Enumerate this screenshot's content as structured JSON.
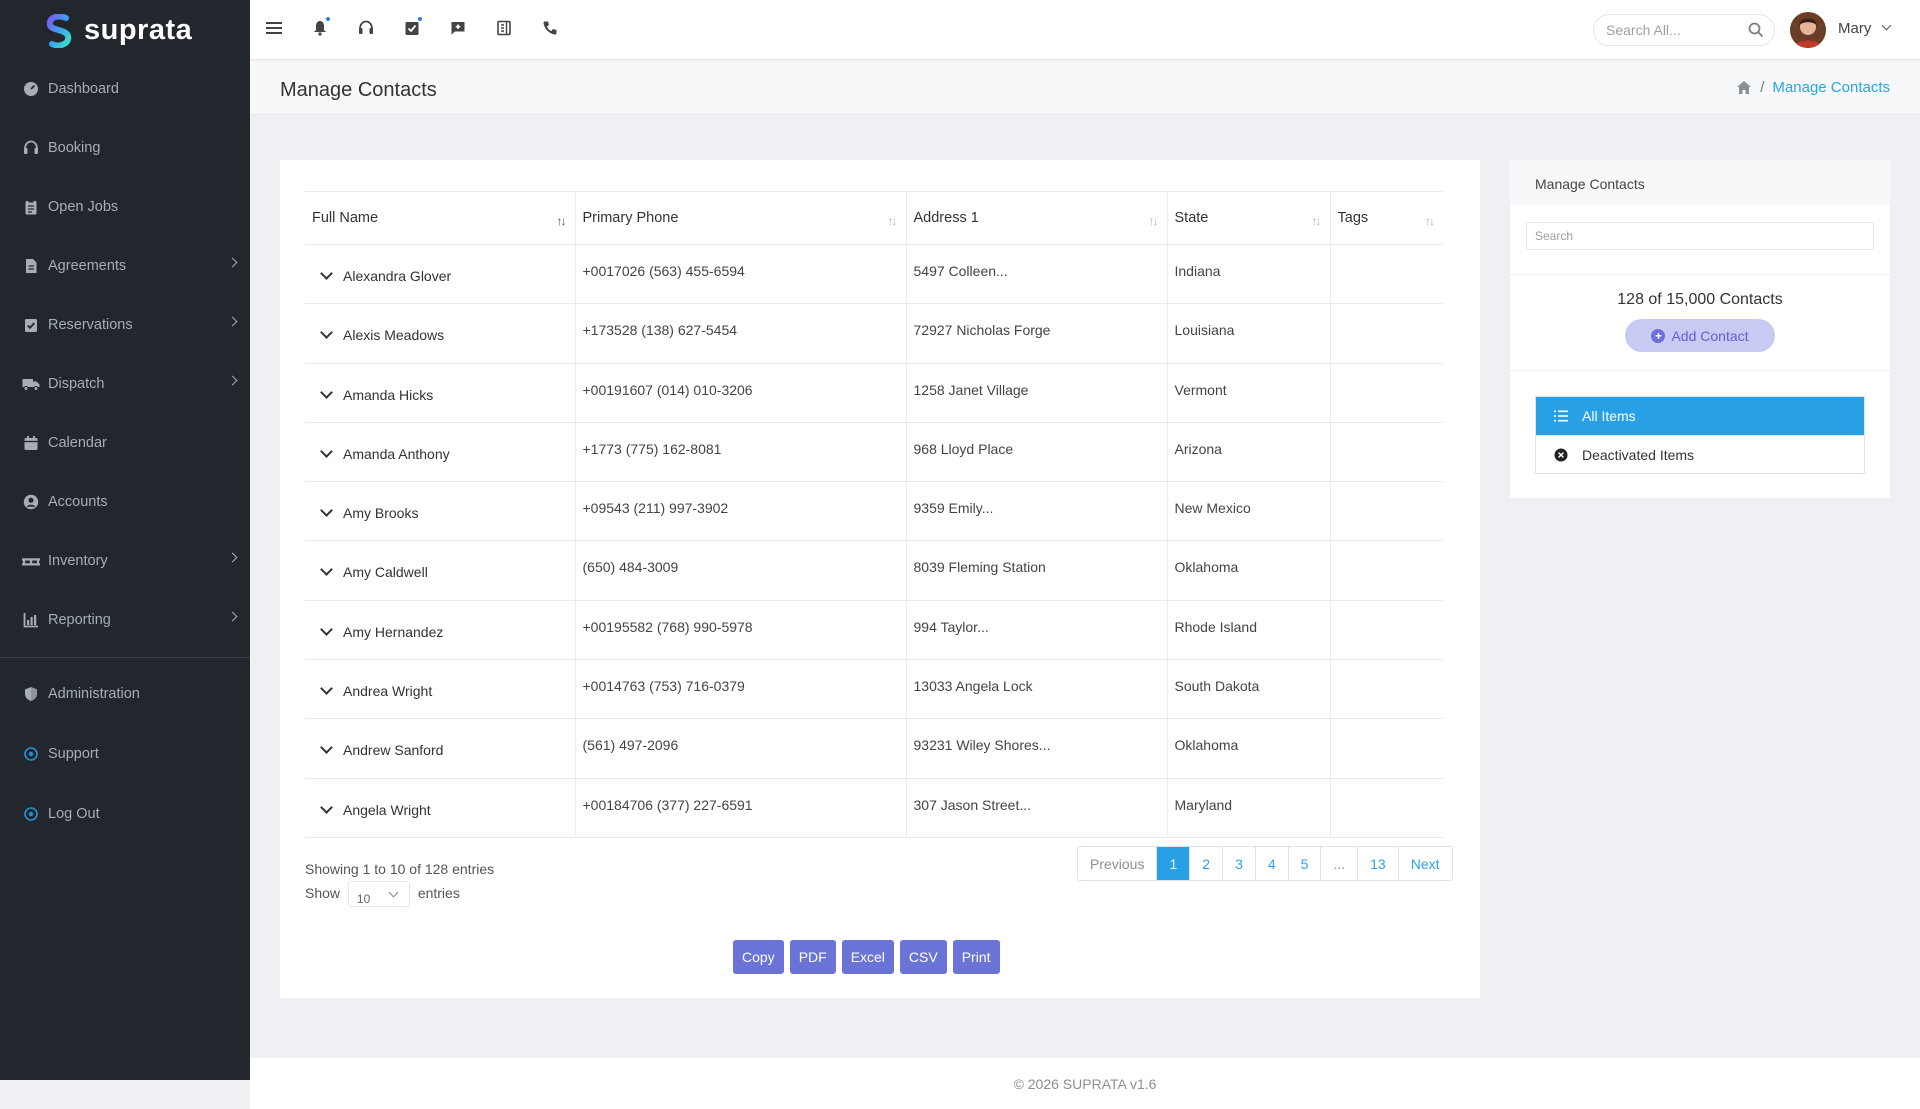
{
  "brand": {
    "name": "suprata"
  },
  "sidebar": {
    "items": [
      {
        "label": "Dashboard",
        "icon": "dashboard-icon",
        "has_submenu": false
      },
      {
        "label": "Booking",
        "icon": "headset-icon",
        "has_submenu": false
      },
      {
        "label": "Open Jobs",
        "icon": "clipboard-icon",
        "has_submenu": false
      },
      {
        "label": "Agreements",
        "icon": "document-icon",
        "has_submenu": true
      },
      {
        "label": "Reservations",
        "icon": "check-clipboard-icon",
        "has_submenu": true
      },
      {
        "label": "Dispatch",
        "icon": "truck-icon",
        "has_submenu": true
      },
      {
        "label": "Calendar",
        "icon": "calendar-icon",
        "has_submenu": false
      },
      {
        "label": "Accounts",
        "icon": "user-circle-icon",
        "has_submenu": false
      },
      {
        "label": "Inventory",
        "icon": "pallet-icon",
        "has_submenu": true
      },
      {
        "label": "Reporting",
        "icon": "chart-icon",
        "has_submenu": true
      }
    ],
    "bottom_items": [
      {
        "label": "Administration",
        "icon": "shield-icon"
      },
      {
        "label": "Support",
        "icon": "support-icon"
      },
      {
        "label": "Log Out",
        "icon": "logout-icon"
      }
    ]
  },
  "topbar": {
    "search_placeholder": "Search All...",
    "user_name": "Mary"
  },
  "page": {
    "title": "Manage Contacts",
    "breadcrumb": [
      "Manage Contacts"
    ]
  },
  "table": {
    "columns": [
      "Full Name",
      "Primary Phone",
      "Address 1",
      "State",
      "Tags"
    ],
    "rows": [
      {
        "name": "Alexandra Glover",
        "phone": "+0017026 (563) 455-6594",
        "address": "5497 Colleen...",
        "state": "Indiana",
        "tags": ""
      },
      {
        "name": "Alexis Meadows",
        "phone": "+173528 (138) 627-5454",
        "address": "72927 Nicholas Forge",
        "state": "Louisiana",
        "tags": ""
      },
      {
        "name": "Amanda Hicks",
        "phone": "+00191607 (014) 010-3206",
        "address": "1258 Janet Village",
        "state": "Vermont",
        "tags": ""
      },
      {
        "name": "Amanda Anthony",
        "phone": "+1773 (775) 162-8081",
        "address": "968 Lloyd Place",
        "state": "Arizona",
        "tags": ""
      },
      {
        "name": "Amy Brooks",
        "phone": "+09543 (211) 997-3902",
        "address": "9359 Emily...",
        "state": "New Mexico",
        "tags": ""
      },
      {
        "name": "Amy Caldwell",
        "phone": "(650) 484-3009",
        "address": "8039 Fleming Station",
        "state": "Oklahoma",
        "tags": ""
      },
      {
        "name": "Amy Hernandez",
        "phone": "+00195582 (768) 990-5978",
        "address": "994 Taylor...",
        "state": "Rhode Island",
        "tags": ""
      },
      {
        "name": "Andrea Wright",
        "phone": "+0014763 (753) 716-0379",
        "address": "13033 Angela Lock",
        "state": "South Dakota",
        "tags": ""
      },
      {
        "name": "Andrew Sanford",
        "phone": "(561) 497-2096",
        "address": "93231 Wiley Shores...",
        "state": "Oklahoma",
        "tags": ""
      },
      {
        "name": "Angela Wright",
        "phone": "+00184706 (377) 227-6591",
        "address": "307 Jason Street...",
        "state": "Maryland",
        "tags": ""
      }
    ],
    "info": "Showing 1 to 10 of 128 entries",
    "show_label": "Show",
    "show_value": "10",
    "entries_label": "entries"
  },
  "pagination": {
    "previous": "Previous",
    "pages": [
      "1",
      "2",
      "3",
      "4",
      "5",
      "...",
      "13"
    ],
    "active": "1",
    "next": "Next"
  },
  "export_buttons": [
    "Copy",
    "PDF",
    "Excel",
    "CSV",
    "Print"
  ],
  "side_panel": {
    "title": "Manage Contacts",
    "search_placeholder": "Search",
    "count_text": "128 of 15,000 Contacts",
    "add_label": "Add Contact",
    "filters": [
      {
        "label": "All Items",
        "active": true,
        "icon": "list-icon"
      },
      {
        "label": "Deactivated Items",
        "active": false,
        "icon": "x-circle-icon"
      }
    ]
  },
  "footer": {
    "text": "© 2026 SUPRATA v1.6"
  },
  "colors": {
    "sidebar_bg": "#22272e",
    "accent": "#27a0e6",
    "button": "#6a73d6"
  }
}
